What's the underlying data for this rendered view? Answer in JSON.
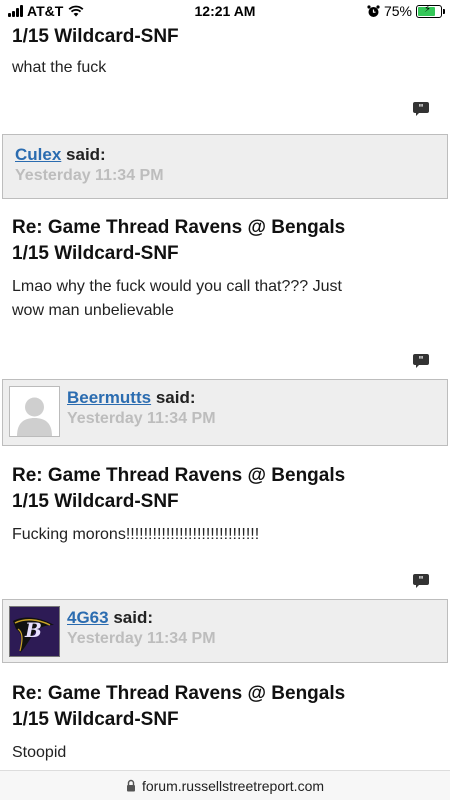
{
  "status_bar": {
    "carrier": "AT&T",
    "time": "12:21 AM",
    "battery_percent": "75%",
    "battery_level": 0.75
  },
  "posts": [
    {
      "title_line2": "1/15 Wildcard-SNF",
      "body": "what the fuck"
    },
    {
      "author": "Culex",
      "said": "said:",
      "time": "Yesterday 11:34 PM",
      "title_line1": "Re: Game Thread Ravens @ Bengals",
      "title_line2": "1/15 Wildcard-SNF",
      "body_line1": "Lmao why the fuck would you call that??? Just",
      "body_line2": "wow man unbelievable"
    },
    {
      "author": "Beermutts",
      "said": "said:",
      "time": "Yesterday 11:34 PM",
      "title_line1": "Re: Game Thread Ravens @ Bengals",
      "title_line2": "1/15 Wildcard-SNF",
      "body": "Fucking morons!!!!!!!!!!!!!!!!!!!!!!!!!!!!!!"
    },
    {
      "author": "4G63",
      "said": "said:",
      "time": "Yesterday 11:34 PM",
      "title_line1": "Re: Game Thread Ravens @ Bengals",
      "title_line2": "1/15 Wildcard-SNF",
      "body": "Stoopid"
    }
  ],
  "url_bar": {
    "domain": "forum.russellstreetreport.com"
  },
  "colors": {
    "link": "#2b6cb0",
    "author_box_bg": "#eeeeee",
    "timestamp": "#bdbdbd",
    "battery": "#35c759"
  },
  "icons": {
    "quote": "quote-icon",
    "lock": "lock-icon",
    "wifi": "wifi-icon",
    "alarm": "alarm-icon"
  }
}
